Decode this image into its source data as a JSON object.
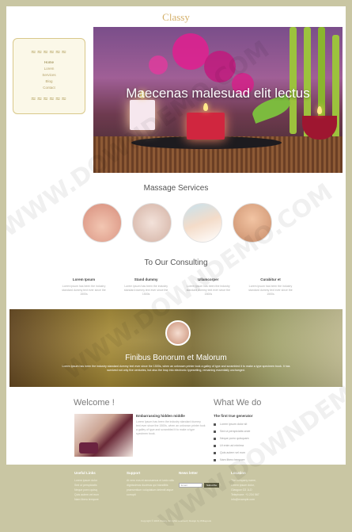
{
  "brand": "Classy",
  "sidebar": {
    "items": [
      "Home",
      "Lorem",
      "Services",
      "Blog",
      "Contact"
    ]
  },
  "hero": {
    "caption": "Maecenas malesuad elit lectus"
  },
  "services": {
    "title": "Massage Services",
    "images": [
      "massage-hands-image",
      "hand-massage-image",
      "facial-massage-image",
      "foot-massage-image"
    ]
  },
  "consulting": {
    "title": "To Our Consulting",
    "columns": [
      {
        "title": "Lorem Ipsum",
        "text": "Lorem ipsum has been the industry standard dummy text ever since the 1500s"
      },
      {
        "title": "Stand dummy",
        "text": "Lorem ipsum has been the industry standard dummy text ever since the 1500s"
      },
      {
        "title": "Ullamcorper",
        "text": "Lorem ipsum has been the industry standard dummy text ever since the 1500s"
      },
      {
        "title": "Curabitur et",
        "text": "Lorem ipsum has been the industry standard dummy text ever since the 1500s"
      }
    ]
  },
  "banner": {
    "title": "Finibus Bonorum et Malorum",
    "text": "Lorem Ipsum has been the industry standard dummy text ever since the 1500s, when an unknown printer took a galley of type and scrambled it to make a type specimen book. It has survived not only five centuries, but also the leap into electronic typesetting, remaining essentially unchanged."
  },
  "welcome": {
    "heading": "Welcome !",
    "subtitle": "Embarrassing hidden middle",
    "text": "Lorem Ipsum has been the industry standard dummy text ever since the 1500s, when an unknown printer took a galley of type and scrambled it to make a type specimen book."
  },
  "whatwedo": {
    "heading": "What We do",
    "subtitle": "The first true generator",
    "items": [
      "Lorem ipsum dolor sit",
      "Sed ut perspiciatis unde",
      "Neque porro quisquam",
      "Ut enim ad minima",
      "Quis autem vel eum",
      "Nam libero tempore"
    ]
  },
  "footer": {
    "useful": {
      "heading": "Useful Links",
      "links": [
        "Lorem ipsum dolor",
        "Sed ut perspiciatis",
        "Neque porro quisq",
        "Quis autem vel eum",
        "Nam libero tempore"
      ]
    },
    "support": {
      "heading": "Support",
      "text": "At vero eos et accusamus et iusto odio dignissimos ducimus qui blanditiis praesentium voluptatum deleniti atque corrupti"
    },
    "news": {
      "heading": "News letter",
      "placeholder": "Email",
      "button": "Subscribe"
    },
    "location": {
      "heading": "Location",
      "lines": [
        "The company name,",
        "Lorem ipsum dolor,",
        "Glasgow G3 1LD",
        "Telephone: +1 234 567",
        "info@example.com"
      ]
    },
    "copyright": "Copyright © 2015 Classy. All rights reserved | Design by W3layouts"
  },
  "watermark": "WWW.DOWNDEMO.COM"
}
